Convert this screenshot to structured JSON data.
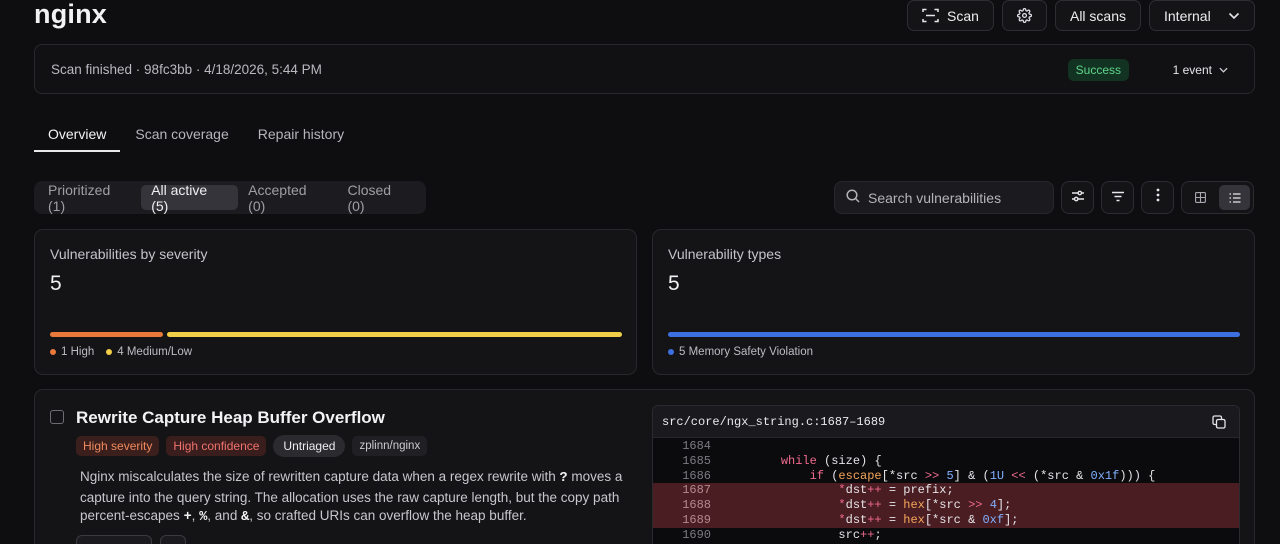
{
  "page": {
    "title": "nginx"
  },
  "header": {
    "scan_label": "Scan",
    "all_scans_label": "All scans",
    "env_label": "Internal"
  },
  "status": {
    "message": "Scan finished · 98fc3bb · 4/18/2026, 5:44 PM",
    "badge": "Success",
    "events": "1 event"
  },
  "tabs": [
    "Overview",
    "Scan coverage",
    "Repair history"
  ],
  "filters": [
    "Prioritized (1)",
    "All active (5)",
    "Accepted (0)",
    "Closed (0)"
  ],
  "search": {
    "placeholder": "Search vulnerabilities"
  },
  "severity_card": {
    "title": "Vulnerabilities by severity",
    "count": "5",
    "breakdown": [
      {
        "label": "1 High",
        "value": 1,
        "color": "#e8793a"
      },
      {
        "label": "4 Medium/Low",
        "value": 4,
        "color": "#f2cf48"
      }
    ]
  },
  "types_card": {
    "title": "Vulnerability types",
    "count": "5",
    "breakdown": [
      {
        "label": "5 Memory Safety Violation",
        "value": 5,
        "color": "#3d6fe0"
      }
    ]
  },
  "vulnerability": {
    "title": "Rewrite Capture Heap Buffer Overflow",
    "severity": "High severity",
    "confidence": "High confidence",
    "status": "Untriaged",
    "repo": "zplinn/nginx",
    "desc_1": "Nginx miscalculates the size of rewritten capture data when a regex rewrite with ",
    "desc_q": "?",
    "desc_2": " moves a capture into the query string. The allocation uses the raw capture length, but the copy path percent-escapes ",
    "desc_plus": "+",
    "desc_3": ", ",
    "desc_pct": "%",
    "desc_4": ", and ",
    "desc_amp": "&",
    "desc_5": ", so crafted URIs can overflow the heap buffer.",
    "code_path": "src/core/ngx_string.c:1687–1689",
    "code_lines": [
      {
        "n": "1684",
        "t": "",
        "hl": false
      },
      {
        "n": "1685",
        "t": "    while (size) {",
        "hl": false
      },
      {
        "n": "1686",
        "t": "        if (escape[*src >> 5] & (1U << (*src & 0x1f))) {",
        "hl": false
      },
      {
        "n": "1687",
        "t": "            *dst++ = prefix;",
        "hl": true
      },
      {
        "n": "1688",
        "t": "            *dst++ = hex[*src >> 4];",
        "hl": true
      },
      {
        "n": "1689",
        "t": "            *dst++ = hex[*src & 0xf];",
        "hl": true
      },
      {
        "n": "1690",
        "t": "            src++;",
        "hl": false
      }
    ]
  }
}
